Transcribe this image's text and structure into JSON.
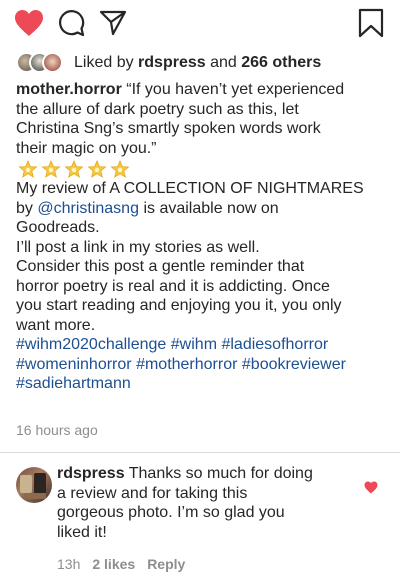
{
  "actions": {
    "like_icon": "heart-filled-icon",
    "comment_icon": "comment-icon",
    "share_icon": "paper-plane-icon",
    "save_icon": "bookmark-icon",
    "like_color": "#ed4956"
  },
  "likes": {
    "prefix": "Liked by",
    "first_user": "rdspress",
    "conjunction": "and",
    "others": "266 others"
  },
  "post": {
    "username": "mother.horror",
    "lines": [
      "“If you haven’t yet experienced",
      "the allure of dark poetry such as this, let",
      "Christina Sng’s smartly spoken words work",
      "their magic on you.”"
    ],
    "star_count": 5,
    "review_line_1": "My review of A COLLECTION OF NIGHTMARES",
    "review_by": "by",
    "mention": "@christinasng",
    "review_line_2_rest": "is available now on",
    "review_line_3": "Goodreads.",
    "stories_line": "I’ll post a link in my stories as well.",
    "reminder_lines": [
      "Consider this post a gentle reminder that",
      "horror poetry is real and it is addicting. Once",
      "you start reading and enjoying you it, you only",
      "want more."
    ],
    "hashtags_line_1": [
      "#wihm2020challenge",
      "#wihm",
      "#ladiesofhorror"
    ],
    "hashtags_line_2": [
      "#womeninhorror",
      "#motherhorror",
      "#bookreviewer"
    ],
    "hashtags_line_3": [
      "#sadiehartmann"
    ],
    "timestamp": "16 hours ago"
  },
  "comment": {
    "username": "rdspress",
    "lines": [
      "Thanks so much for doing",
      "a review and for taking this",
      "gorgeous photo. I’m so glad you",
      "liked it!"
    ],
    "time": "13h",
    "likes": "2 likes",
    "reply": "Reply",
    "like_icon": "heart-small-icon"
  }
}
